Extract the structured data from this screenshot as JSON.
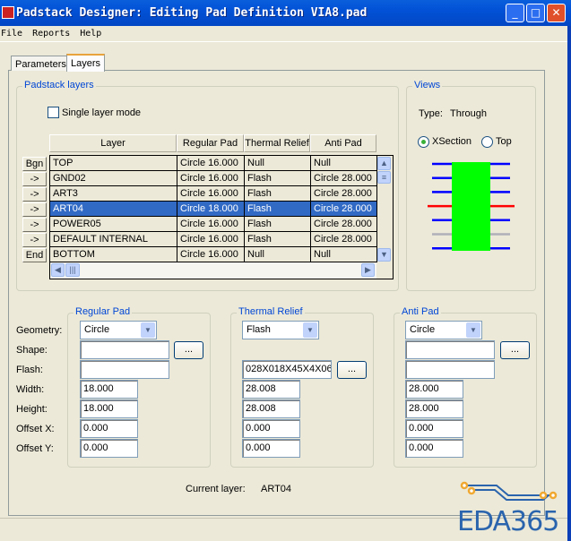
{
  "window": {
    "title": "Padstack Designer: Editing Pad Definition VIA8.pad"
  },
  "menu": [
    "File",
    "Reports",
    "Help"
  ],
  "tabs": [
    "Parameters",
    "Layers"
  ],
  "layers_group": {
    "title": "Padstack layers",
    "single_layer_mode": "Single layer mode",
    "single_layer_checked": false,
    "columns": [
      "Layer",
      "Regular Pad",
      "Thermal Relief",
      "Anti Pad"
    ],
    "rows": [
      {
        "btn": "Bgn",
        "layer": "TOP",
        "regular": "Circle 16.000",
        "thermal": "Null",
        "anti": "Null"
      },
      {
        "btn": "->",
        "layer": "GND02",
        "regular": "Circle 16.000",
        "thermal": "Flash",
        "anti": "Circle 28.000"
      },
      {
        "btn": "->",
        "layer": "ART3",
        "regular": "Circle 16.000",
        "thermal": "Flash",
        "anti": "Circle 28.000"
      },
      {
        "btn": "->",
        "layer": "ART04",
        "regular": "Circle 18.000",
        "thermal": "Flash",
        "anti": "Circle 28.000",
        "selected": true
      },
      {
        "btn": "->",
        "layer": "POWER05",
        "regular": "Circle 16.000",
        "thermal": "Flash",
        "anti": "Circle 28.000"
      },
      {
        "btn": "->",
        "layer": "DEFAULT INTERNAL",
        "regular": "Circle 16.000",
        "thermal": "Flash",
        "anti": "Circle 28.000"
      },
      {
        "btn": "End",
        "layer": "BOTTOM",
        "regular": "Circle 16.000",
        "thermal": "Null",
        "anti": "Null"
      }
    ]
  },
  "views": {
    "title": "Views",
    "type_label": "Type:",
    "type_value": "Through",
    "xsection": "XSection",
    "top": "Top",
    "selected": "XSection"
  },
  "labels": {
    "geometry": "Geometry:",
    "shape": "Shape:",
    "flash": "Flash:",
    "width": "Width:",
    "height": "Height:",
    "offset_x": "Offset X:",
    "offset_y": "Offset Y:"
  },
  "regular": {
    "title": "Regular Pad",
    "geometry": "Circle",
    "shape": "",
    "flash": "",
    "width": "18.000",
    "height": "18.000",
    "offset_x": "0.000",
    "offset_y": "0.000"
  },
  "thermal": {
    "title": "Thermal Relief",
    "geometry": "Flash",
    "flash": "028X018X45X4X06",
    "width": "28.008",
    "height": "28.008",
    "offset_x": "0.000",
    "offset_y": "0.000"
  },
  "anti": {
    "title": "Anti Pad",
    "geometry": "Circle",
    "shape": "",
    "flash": "",
    "width": "28.000",
    "height": "28.000",
    "offset_x": "0.000",
    "offset_y": "0.000"
  },
  "browse_label": "...",
  "current_layer": {
    "label": "Current layer:",
    "value": "ART04"
  },
  "watermark": "EDA365",
  "colors": {
    "title": "#0251d6",
    "selection": "#316ac5",
    "pad": "#00ff00",
    "layer": "#0000ff",
    "current": "#ff0000"
  }
}
